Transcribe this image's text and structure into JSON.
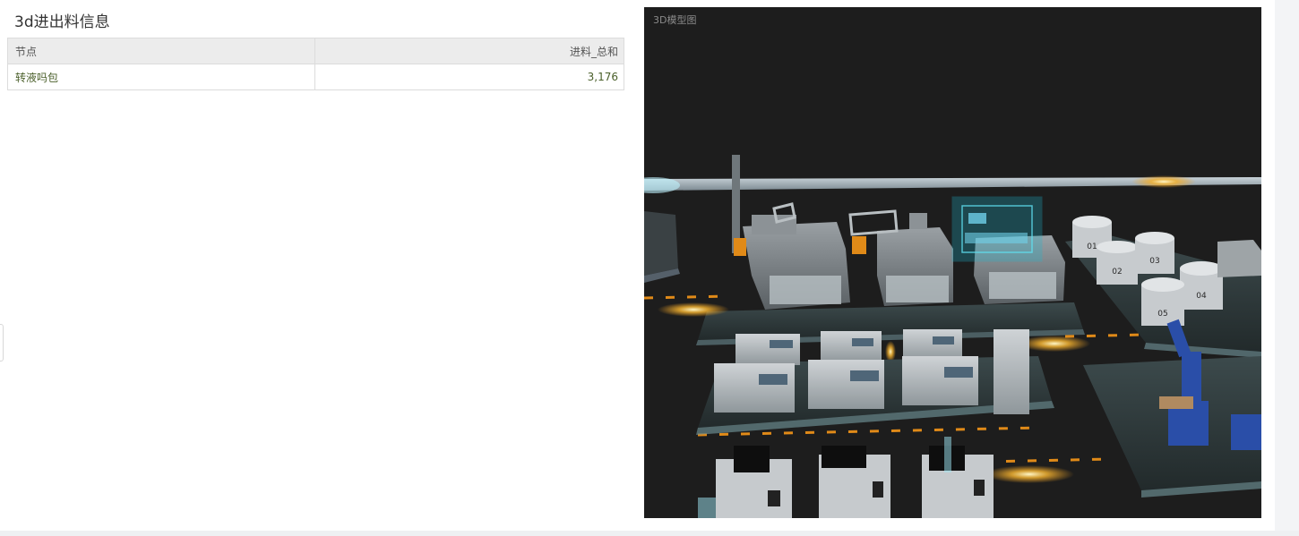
{
  "left_panel": {
    "title": "3d进出料信息",
    "table": {
      "headers": [
        "节点",
        "进料_总和"
      ],
      "rows": [
        [
          "转液吗包",
          "3,176"
        ]
      ]
    }
  },
  "viewport": {
    "title": "3D模型图",
    "background_color": "#1d1d1d",
    "tank_labels": [
      "01",
      "02",
      "03",
      "04",
      "05"
    ]
  },
  "colors": {
    "accent_orange": "#f0a020",
    "hologram_cyan": "#1fb8d0",
    "robot_blue": "#2a4ea8"
  }
}
